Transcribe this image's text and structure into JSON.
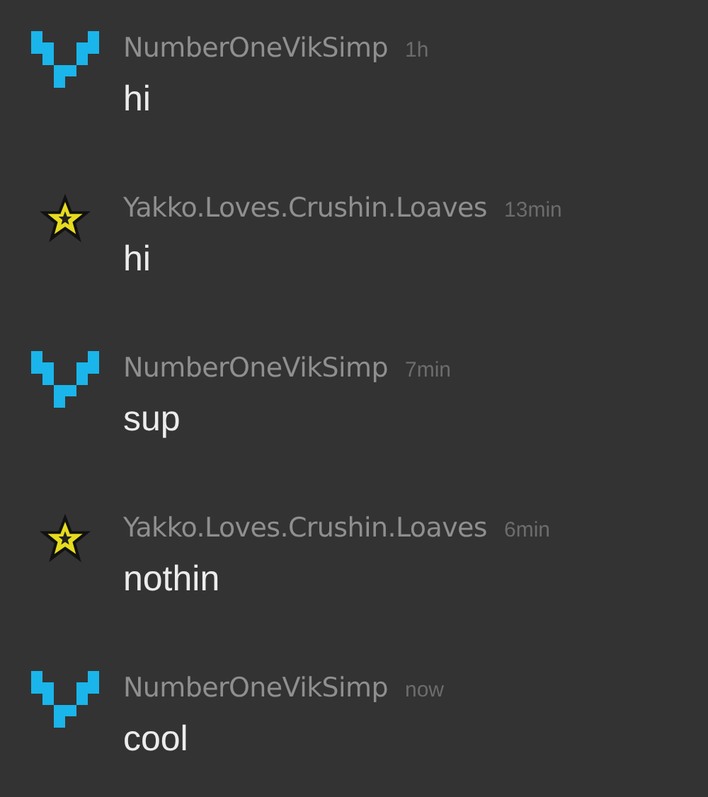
{
  "messages": [
    {
      "avatar": {
        "kind": "pixel-v"
      },
      "author": "NumberOneVikSimp",
      "time": "1h",
      "text": "hi"
    },
    {
      "avatar": {
        "kind": "star"
      },
      "author": "Yakko.Loves.Crushin.Loaves",
      "time": "13min",
      "text": "hi"
    },
    {
      "avatar": {
        "kind": "pixel-v"
      },
      "author": "NumberOneVikSimp",
      "time": "7min",
      "text": "sup"
    },
    {
      "avatar": {
        "kind": "star"
      },
      "author": "Yakko.Loves.Crushin.Loaves",
      "time": "6min",
      "text": "nothin"
    },
    {
      "avatar": {
        "kind": "pixel-v"
      },
      "author": "NumberOneVikSimp",
      "time": "now",
      "text": "cool"
    }
  ]
}
